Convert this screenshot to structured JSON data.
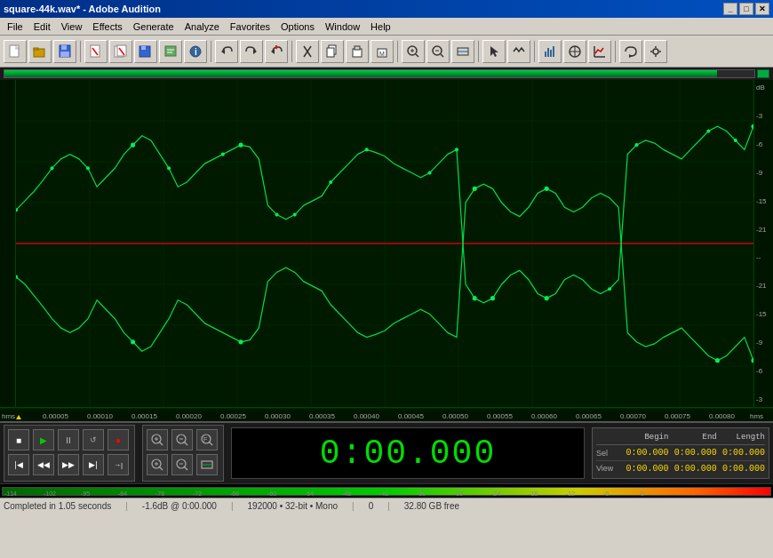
{
  "title": "square-44k.wav* - Adobe Audition",
  "menu": {
    "items": [
      "File",
      "Edit",
      "View",
      "Effects",
      "Generate",
      "Analyze",
      "Favorites",
      "Options",
      "Window",
      "Help"
    ]
  },
  "titlebar": {
    "minimize": "_",
    "maximize": "□",
    "close": "✕"
  },
  "waveform": {
    "db_labels": [
      "dB",
      "-3",
      "-6",
      "-9",
      "-15",
      "-21",
      "--",
      "-21",
      "-15",
      "-9",
      "-6",
      "-3"
    ],
    "time_labels": [
      "hms",
      "0.00005",
      "0.00010",
      "0.00015",
      "0.00020",
      "0.00025",
      "0.00030",
      "0.00035",
      "0.00040",
      "0.00045",
      "0.00050",
      "0.00055",
      "0.00060",
      "0.00065",
      "0.00070",
      "0.00075",
      "0.00080",
      "hms"
    ]
  },
  "transport": {
    "time_display": "0:00.000",
    "buttons": {
      "stop": "■",
      "play": "▶",
      "pause": "⏸",
      "loop": "↻",
      "record": "●",
      "rewind_start": "⏮",
      "rewind": "◀◀",
      "forward": "▶▶",
      "forward_end": "⏭",
      "prev_marker": "←|"
    }
  },
  "begin_end": {
    "headers": [
      "Begin",
      "End",
      "Length"
    ],
    "sel_label": "Sel",
    "view_label": "View",
    "sel_begin": "0:00.000",
    "sel_end": "0:00.000",
    "sel_length": "0:00.000",
    "view_begin": "0:00.000",
    "view_end": "0:00.000",
    "view_length": "0:00.000"
  },
  "status_bar": {
    "completed": "Completed in 1.05 seconds",
    "level": "-1.6dB @ 0:00.000",
    "sample_info": "192000 • 32-bit • Mono",
    "selection": "0",
    "free": "32.80 GB free"
  },
  "level_meter": {
    "ticks": [
      "-114",
      "-102",
      "-95",
      "-84",
      "-78",
      "-72",
      "-66",
      "-60",
      "-54",
      "-48",
      "-42",
      "-36",
      "-30",
      "-24",
      "-18",
      "-12",
      "-6",
      "0"
    ]
  }
}
